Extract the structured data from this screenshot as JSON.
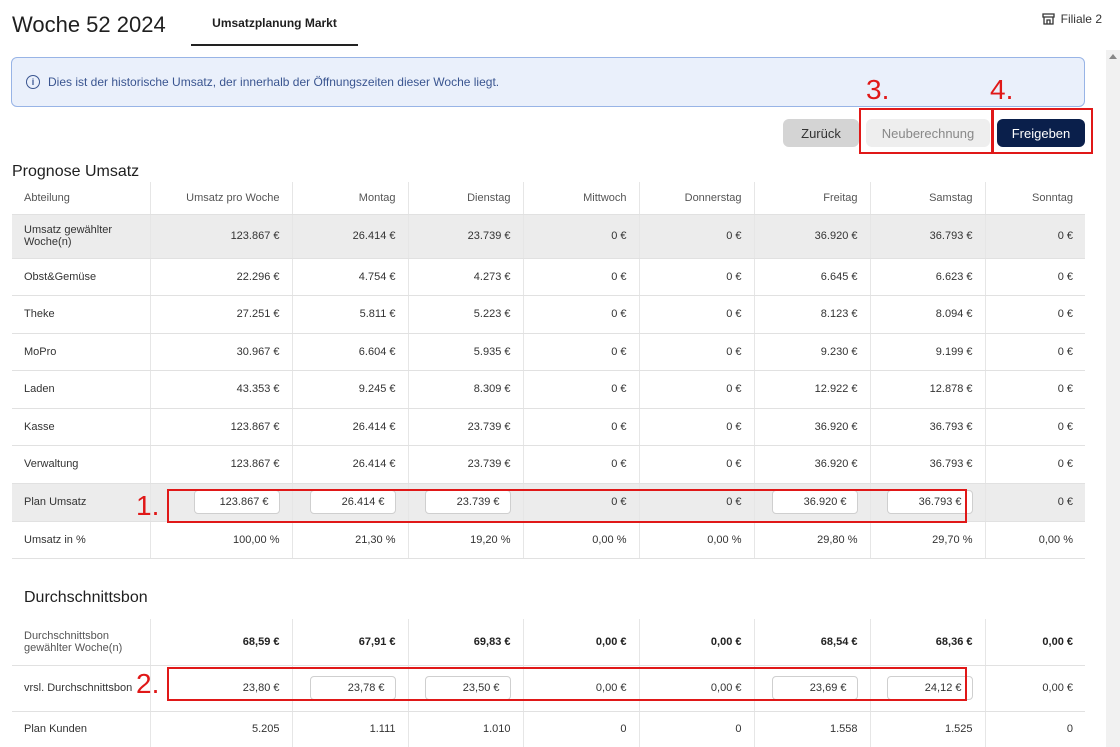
{
  "header": {
    "title": "Woche 52 2024",
    "tab_label": "Umsatzplanung Markt",
    "store_label": "Filiale 2"
  },
  "info": {
    "text": "Dies ist der historische Umsatz, der innerhalb der Öffnungszeiten dieser Woche liegt."
  },
  "buttons": {
    "back": "Zurück",
    "recalc": "Neuberechnung",
    "release": "Freigeben"
  },
  "forecast": {
    "title": "Prognose Umsatz",
    "columns": [
      "Abteilung",
      "Umsatz pro Woche",
      "Montag",
      "Dienstag",
      "Mittwoch",
      "Donnerstag",
      "Freitag",
      "Samstag",
      "Sonntag"
    ],
    "rows": [
      {
        "label": "Umsatz gewählter Woche(n)",
        "values": [
          "123.867 €",
          "26.414 €",
          "23.739 €",
          "0 €",
          "0 €",
          "36.920 €",
          "36.793 €",
          "0 €"
        ]
      },
      {
        "label": "Obst&Gemüse",
        "values": [
          "22.296 €",
          "4.754 €",
          "4.273 €",
          "0 €",
          "0 €",
          "6.645 €",
          "6.623 €",
          "0 €"
        ]
      },
      {
        "label": "Theke",
        "values": [
          "27.251 €",
          "5.811 €",
          "5.223 €",
          "0 €",
          "0 €",
          "8.123 €",
          "8.094 €",
          "0 €"
        ]
      },
      {
        "label": "MoPro",
        "values": [
          "30.967 €",
          "6.604 €",
          "5.935 €",
          "0 €",
          "0 €",
          "9.230 €",
          "9.199 €",
          "0 €"
        ]
      },
      {
        "label": "Laden",
        "values": [
          "43.353 €",
          "9.245 €",
          "8.309 €",
          "0 €",
          "0 €",
          "12.922 €",
          "12.878 €",
          "0 €"
        ]
      },
      {
        "label": "Kasse",
        "values": [
          "123.867 €",
          "26.414 €",
          "23.739 €",
          "0 €",
          "0 €",
          "36.920 €",
          "36.793 €",
          "0 €"
        ]
      },
      {
        "label": "Verwaltung",
        "values": [
          "123.867 €",
          "26.414 €",
          "23.739 €",
          "0 €",
          "0 €",
          "36.920 €",
          "36.793 €",
          "0 €"
        ]
      }
    ],
    "plan_row": {
      "label": "Plan Umsatz",
      "values": [
        "123.867 €",
        "26.414 €",
        "23.739 €",
        "0 €",
        "0 €",
        "36.920 €",
        "36.793 €",
        "0 €"
      ]
    },
    "percent_row": {
      "label": "Umsatz in %",
      "values": [
        "100,00 %",
        "21,30 %",
        "19,20 %",
        "0,00 %",
        "0,00 %",
        "29,80 %",
        "29,70 %",
        "0,00 %"
      ]
    }
  },
  "avg_receipt": {
    "title": "Durchschnittsbon",
    "rows": [
      {
        "label": "Durchschnittsbon gewählter Woche(n)",
        "values": [
          "68,59 €",
          "67,91 €",
          "69,83 €",
          "0,00 €",
          "0,00 €",
          "68,54 €",
          "68,36 €",
          "0,00 €"
        ]
      },
      {
        "label": "vrsl. Durchschnittsbon",
        "values": [
          "23,80 €",
          "23,78 €",
          "23,50 €",
          "0,00 €",
          "0,00 €",
          "23,69 €",
          "24,12 €",
          "0,00 €"
        ]
      },
      {
        "label": "Plan Kunden",
        "values": [
          "5.205",
          "1.111",
          "1.010",
          "0",
          "0",
          "1.558",
          "1.525",
          "0"
        ]
      }
    ]
  },
  "annotations": [
    "1.",
    "2.",
    "3.",
    "4."
  ],
  "colors": {
    "annotation": "#e01818",
    "primary": "#0a1f4b",
    "info_bg": "#eaf0fb"
  }
}
